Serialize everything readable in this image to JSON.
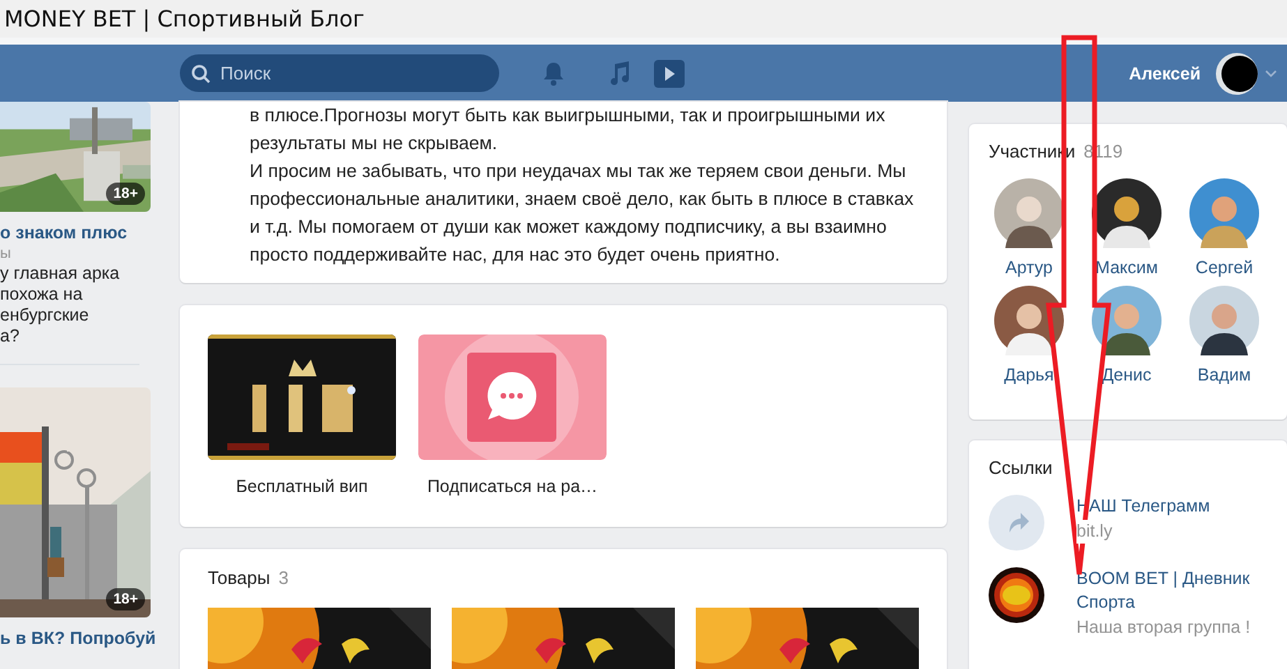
{
  "window": {
    "title": "MONEY BET | Спортивный Блог"
  },
  "header": {
    "search": {
      "placeholder": "Поиск"
    },
    "user": {
      "name": "Алексей"
    }
  },
  "left_feed": [
    {
      "badge": "18+",
      "title": "о знаком плюс",
      "meta": "ы",
      "lines": [
        "у главная арка",
        "похожа на",
        "енбургские",
        "а?"
      ]
    },
    {
      "badge": "18+",
      "title": "ь в ВК? Попробуй"
    }
  ],
  "post": {
    "paragraphs": [
      "в плюсе.Прогнозы могут быть как выигрышными, так и проигрышными их результаты мы не скрываем.",
      "И просим не забывать, что при неудачах мы так же теряем свои деньги. Мы профессиональные аналитики, знаем своё дело, как быть в плюсе в ставках и т.д. Мы помогаем от души как может каждому подписчику, а вы взаимно просто поддерживайте нас, для нас это будет очень приятно."
    ]
  },
  "apps": [
    {
      "kind": "vip",
      "label": "Бесплатный вип"
    },
    {
      "kind": "chat",
      "label": "Подписаться на ра…"
    }
  ],
  "goods": {
    "title": "Товары",
    "count": "3"
  },
  "members": {
    "title": "Участники",
    "count": "8119",
    "people": [
      {
        "name": "Артур"
      },
      {
        "name": "Максим"
      },
      {
        "name": "Сергей"
      },
      {
        "name": "Дарья"
      },
      {
        "name": "Денис"
      },
      {
        "name": "Вадим"
      }
    ]
  },
  "links": {
    "title": "Ссылки",
    "items": [
      {
        "kind": "link",
        "title": "НАШ Телеграмм",
        "subtitle": "bit.ly"
      },
      {
        "kind": "group",
        "title": "BOOM BET | Дневник Спорта",
        "subtitle": "Наша вторая группа !"
      }
    ]
  }
}
